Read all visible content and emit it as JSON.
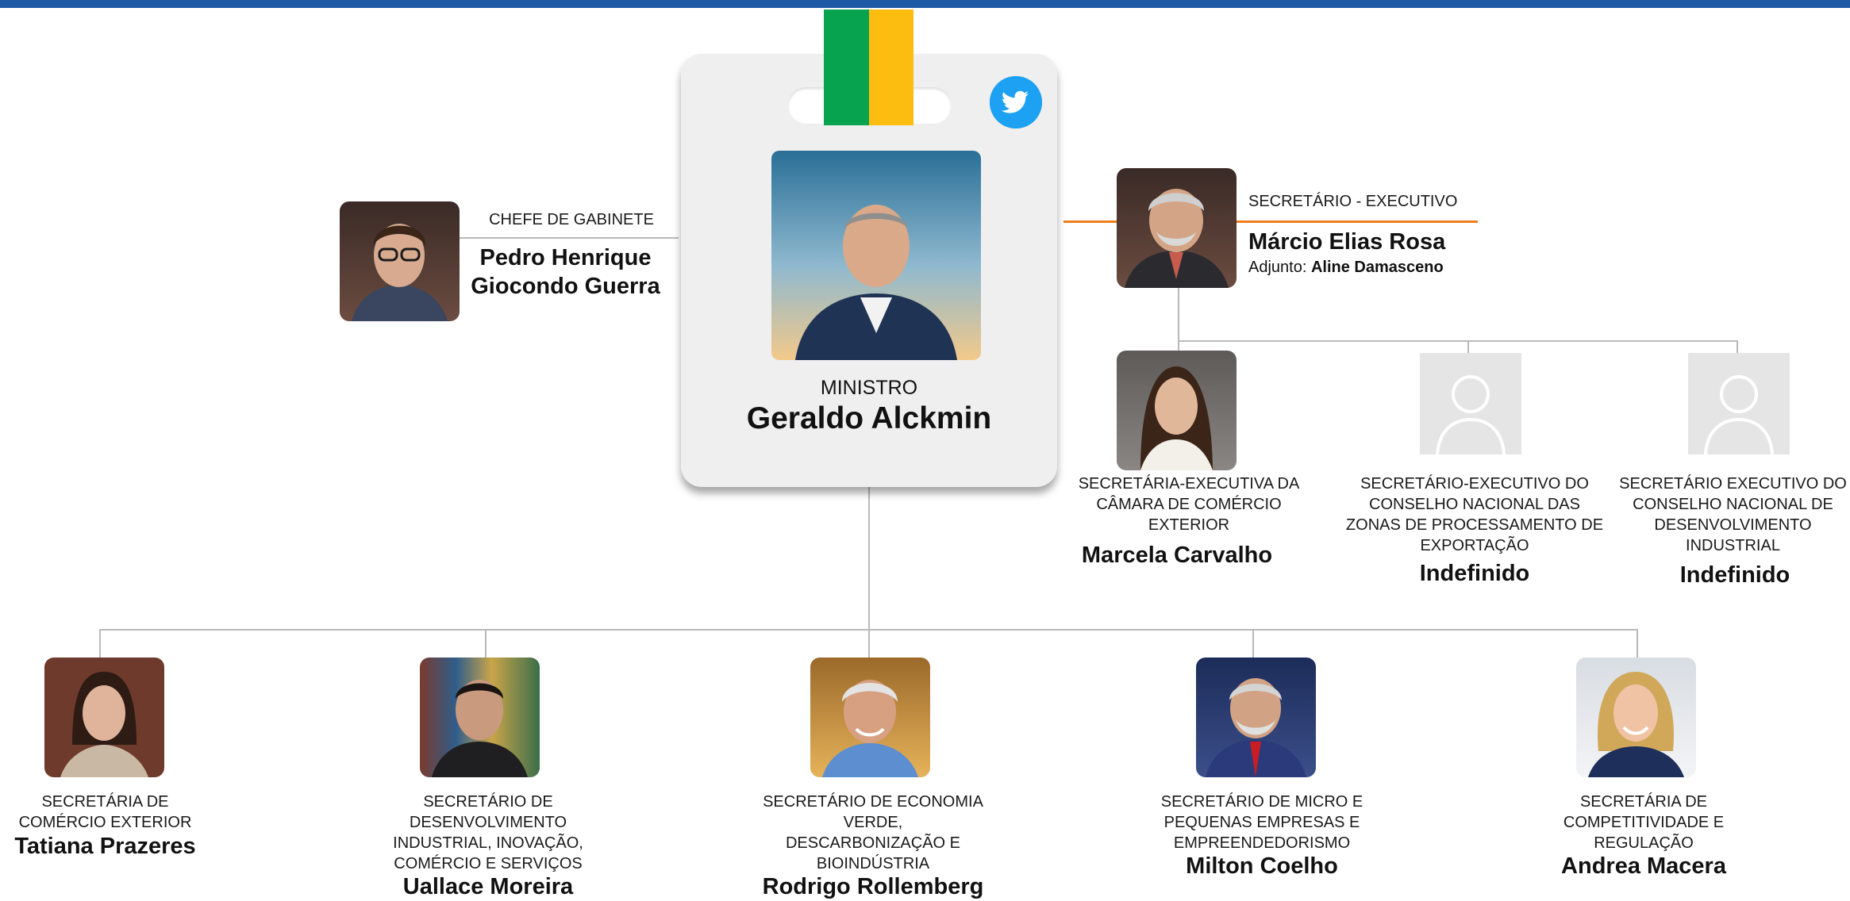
{
  "colors": {
    "top_bar": "#1f5aa6",
    "strap_green": "#08a34f",
    "strap_yellow": "#fdbd10",
    "connector_gray": "#b9b9b9",
    "connector_orange": "#ee7d1c",
    "twitter_blue": "#1da1f2",
    "card_bg": "#efefef"
  },
  "icons": {
    "twitter": "twitter-bird-icon",
    "placeholder": "user-silhouette-icon"
  },
  "minister": {
    "role": "MINISTRO",
    "name": "Geraldo Alckmin"
  },
  "chief_of_staff": {
    "role": "CHEFE DE GABINETE",
    "name_line1": "Pedro Henrique",
    "name_line2": "Giocondo Guerra"
  },
  "executive_secretary": {
    "role": "SECRETÁRIO - EXECUTIVO",
    "name": "Márcio Elias Rosa",
    "deputy_prefix": "Adjunto:",
    "deputy_name": "Aline Damasceno"
  },
  "executive_reports": [
    {
      "role_lines": [
        "SECRETÁRIA-EXECUTIVA DA",
        "CÂMARA DE COMÉRCIO",
        "EXTERIOR"
      ],
      "name": "Marcela Carvalho"
    },
    {
      "role_lines": [
        "SECRETÁRIO-EXECUTIVO DO",
        "CONSELHO NACIONAL DAS",
        "ZONAS DE PROCESSAMENTO DE",
        "EXPORTAÇÃO"
      ],
      "name": "Indefinido"
    },
    {
      "role_lines": [
        "SECRETÁRIO EXECUTIVO DO",
        "CONSELHO NACIONAL DE",
        "DESENVOLVIMENTO",
        "INDUSTRIAL"
      ],
      "name": "Indefinido"
    }
  ],
  "secretaries": [
    {
      "role_lines": [
        "SECRETÁRIA DE",
        "COMÉRCIO EXTERIOR"
      ],
      "name": "Tatiana Prazeres"
    },
    {
      "role_lines": [
        "SECRETÁRIO DE",
        "DESENVOLVIMENTO",
        "INDUSTRIAL, INOVAÇÃO,",
        "COMÉRCIO E SERVIÇOS"
      ],
      "name": "Uallace Moreira"
    },
    {
      "role_lines": [
        "SECRETÁRIO DE ECONOMIA",
        "VERDE,",
        "DESCARBONIZAÇÃO E",
        "BIOINDÚSTRIA"
      ],
      "name": "Rodrigo Rollemberg"
    },
    {
      "role_lines": [
        "SECRETÁRIO DE MICRO E",
        "PEQUENAS EMPRESAS E",
        "EMPREENDEDORISMO"
      ],
      "name": "Milton Coelho"
    },
    {
      "role_lines": [
        "SECRETÁRIA DE",
        "COMPETITIVIDADE E",
        "REGULAÇÃO"
      ],
      "name": "Andrea Macera"
    }
  ]
}
